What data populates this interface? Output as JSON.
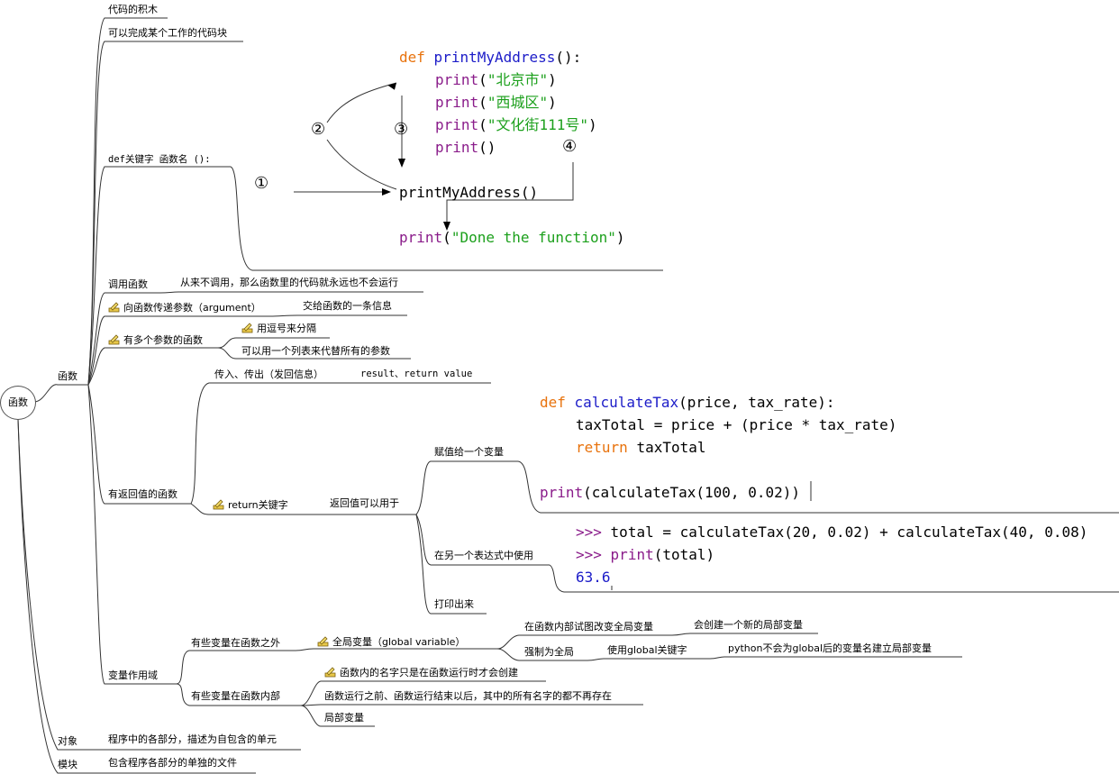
{
  "root": "函数",
  "branches": {
    "functions": "函数",
    "objects": "对象",
    "modules": "模块"
  },
  "top_items": [
    "代码的积木",
    "可以完成某个工作的代码块"
  ],
  "def_label": "def关键字 函数名 ():",
  "call": {
    "label": "调用函数",
    "note": "从来不调用，那么函数里的代码就永远也不会运行"
  },
  "pass_args": {
    "label": "向函数传递参数（argument）",
    "note": "交给函数的一条信息"
  },
  "multi_args": {
    "label": "有多个参数的函数",
    "notes": [
      "用逗号来分隔",
      "可以用一个列表来代替所有的参数"
    ]
  },
  "return_func": {
    "label": "有返回值的函数",
    "io": "传入、传出（发回信息）",
    "io_note": "result、return value",
    "keyword": "return关键字",
    "uses_label": "返回值可以用于",
    "uses": [
      "赋值给一个变量",
      "在另一个表达式中使用",
      "打印出来"
    ]
  },
  "scope": {
    "label": "变量作用域",
    "outside": "有些变量在函数之外",
    "global_var": "全局变量（global variable）",
    "modify": "在函数内部试图改变全局变量",
    "modify_note": "会创建一个新的局部变量",
    "force": "强制为全局",
    "use_global": "使用global关键字",
    "python_note": "python不会为global后的变量名建立局部变量",
    "inside": "有些变量在函数内部",
    "inside_notes": [
      "函数内的名字只是在函数运行时才会创建",
      "函数运行之前、函数运行结束以后，其中的所有名字的都不再存在",
      "局部变量"
    ]
  },
  "objects_note": "程序中的各部分，描述为自包含的单元",
  "modules_note": "包含程序各部分的单独的文件",
  "code1": {
    "def": "def",
    "fname": "printMyAddress",
    "paren": "():",
    "print": "print",
    "lines": [
      "\"北京市\"",
      "\"西城区\"",
      "\"文化街111号\""
    ],
    "empty_print": "()",
    "call": "printMyAddress()",
    "final_str": "\"Done the function\""
  },
  "markers": [
    "①",
    "②",
    "③",
    "④"
  ],
  "code2": {
    "def": "def",
    "fname": "calculateTax",
    "params": "(price, tax_rate):",
    "line2": "taxTotal = price + (price * tax_rate)",
    "ret": "return",
    "ret_val": "taxTotal",
    "print": "print",
    "print_arg": "(calculateTax(100, 0.02))"
  },
  "code3": {
    "prompt": ">>>",
    "line1": "total = calculateTax(20, 0.02) + calculateTax(40, 0.08)",
    "print": "print",
    "print_arg": "(total)",
    "result": "63.6"
  }
}
